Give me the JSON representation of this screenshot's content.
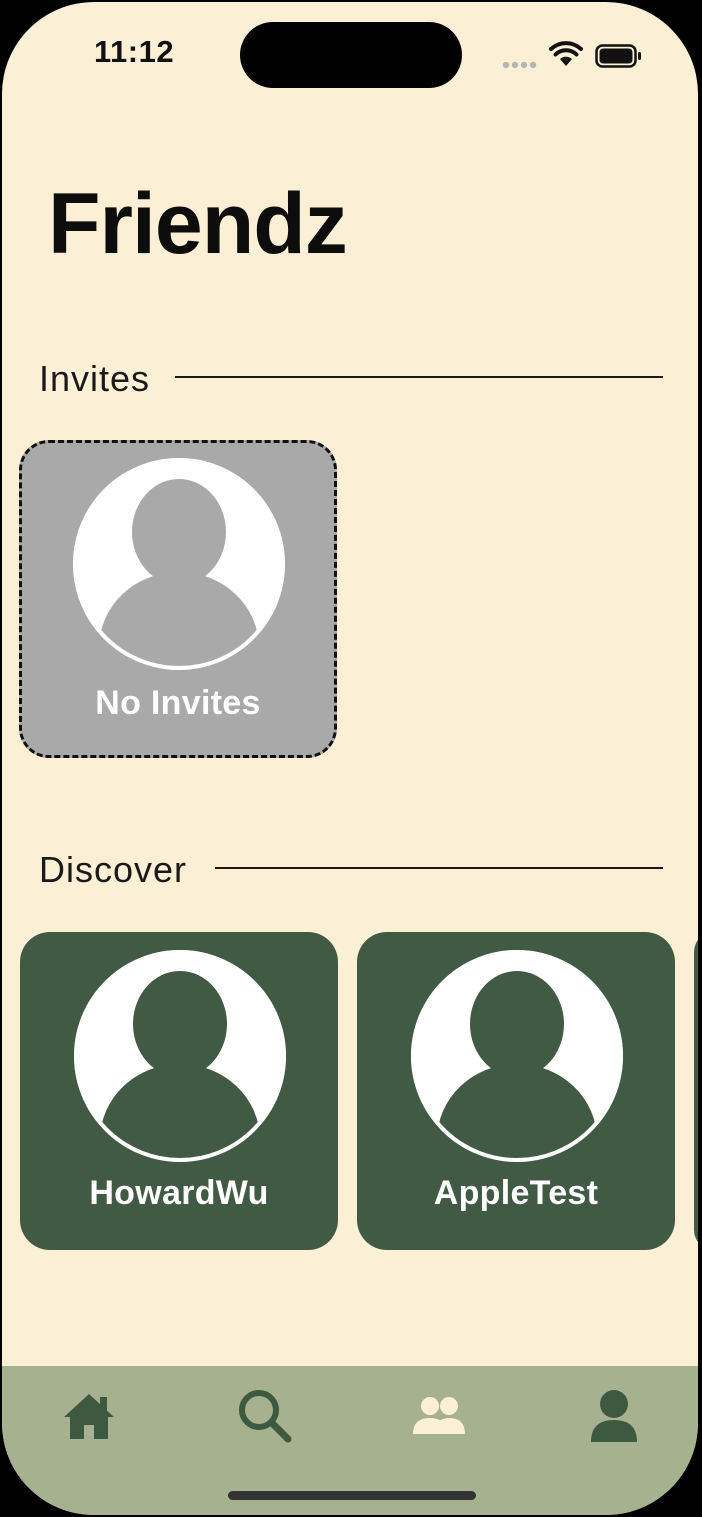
{
  "status_bar": {
    "time": "11:12",
    "icons": [
      "signal-dots-icon",
      "wifi-icon",
      "battery-icon"
    ]
  },
  "page": {
    "title": "Friendz"
  },
  "invites": {
    "section_label": "Invites",
    "empty_card": {
      "label": "No Invites",
      "icon": "default-avatar-icon"
    }
  },
  "discover": {
    "section_label": "Discover",
    "users": [
      {
        "name": "HowardWu",
        "icon": "default-avatar-icon"
      },
      {
        "name": "AppleTest",
        "icon": "default-avatar-icon"
      }
    ]
  },
  "tab_bar": {
    "tabs": [
      {
        "name": "home",
        "icon": "home-icon",
        "active": false
      },
      {
        "name": "search",
        "icon": "search-icon",
        "active": false
      },
      {
        "name": "friends",
        "icon": "friends-icon",
        "active": true
      },
      {
        "name": "profile",
        "icon": "profile-icon",
        "active": false
      }
    ]
  },
  "colors": {
    "background": "#fbf0d6",
    "card_green": "#415a44",
    "card_gray": "#a9a9a9",
    "tab_bar": "#a6b190",
    "tab_icon": "#3d5a41",
    "tab_icon_active": "#fbf0d6"
  }
}
